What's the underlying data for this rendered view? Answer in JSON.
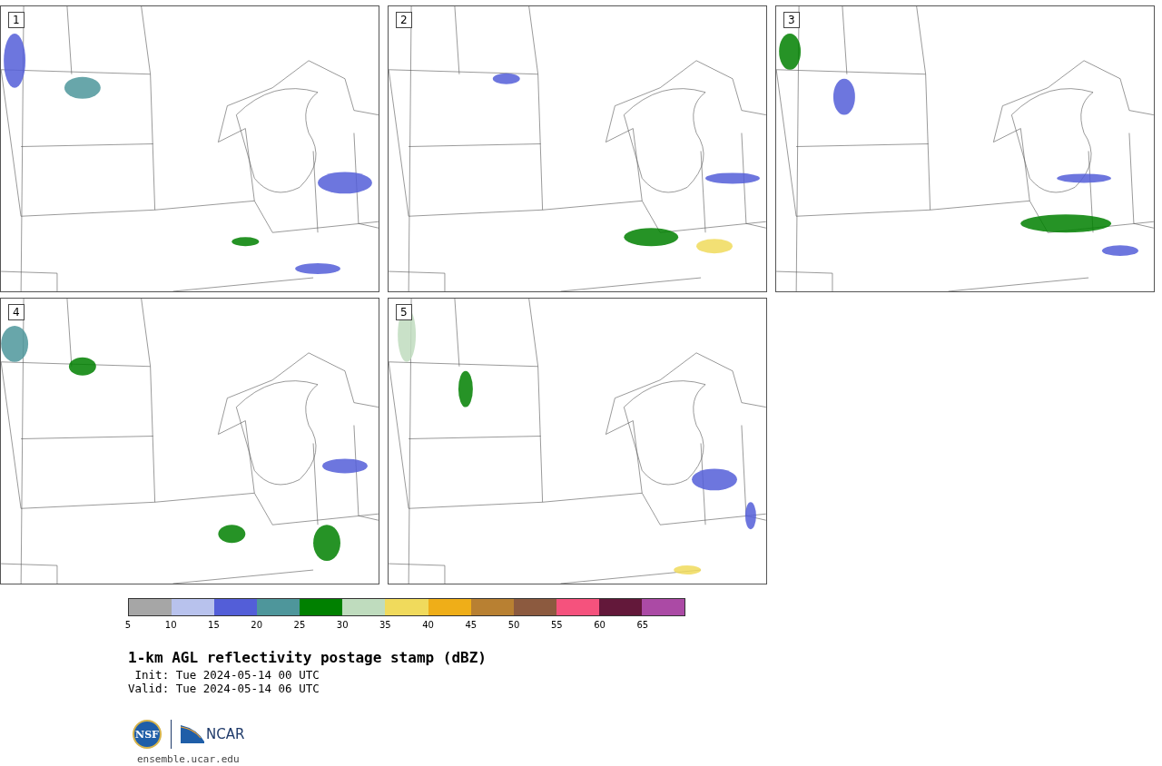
{
  "panels": [
    {
      "label": "1"
    },
    {
      "label": "2"
    },
    {
      "label": "3"
    },
    {
      "label": "4"
    },
    {
      "label": "5"
    }
  ],
  "colorbar": {
    "bins": [
      {
        "color": "#a6a6a6"
      },
      {
        "color": "#b8c2ed"
      },
      {
        "color": "#535ed8"
      },
      {
        "color": "#4e969b"
      },
      {
        "color": "#008000"
      },
      {
        "color": "#bfdcbe"
      },
      {
        "color": "#f0da5c"
      },
      {
        "color": "#efae18"
      },
      {
        "color": "#b88032"
      },
      {
        "color": "#8c5a3f"
      },
      {
        "color": "#f5527d"
      },
      {
        "color": "#63183a"
      },
      {
        "color": "#ab4aa5"
      }
    ],
    "ticks": [
      "5",
      "10",
      "15",
      "20",
      "25",
      "30",
      "35",
      "40",
      "45",
      "50",
      "55",
      "60",
      "65"
    ]
  },
  "title": "1-km AGL reflectivity postage stamp (dBZ)",
  "init": " Init: Tue 2024-05-14 00 UTC",
  "valid": "Valid: Tue 2024-05-14 06 UTC",
  "logos": {
    "nsf": "NSF",
    "ncar": "NCAR"
  },
  "site": "ensemble.ucar.edu"
}
